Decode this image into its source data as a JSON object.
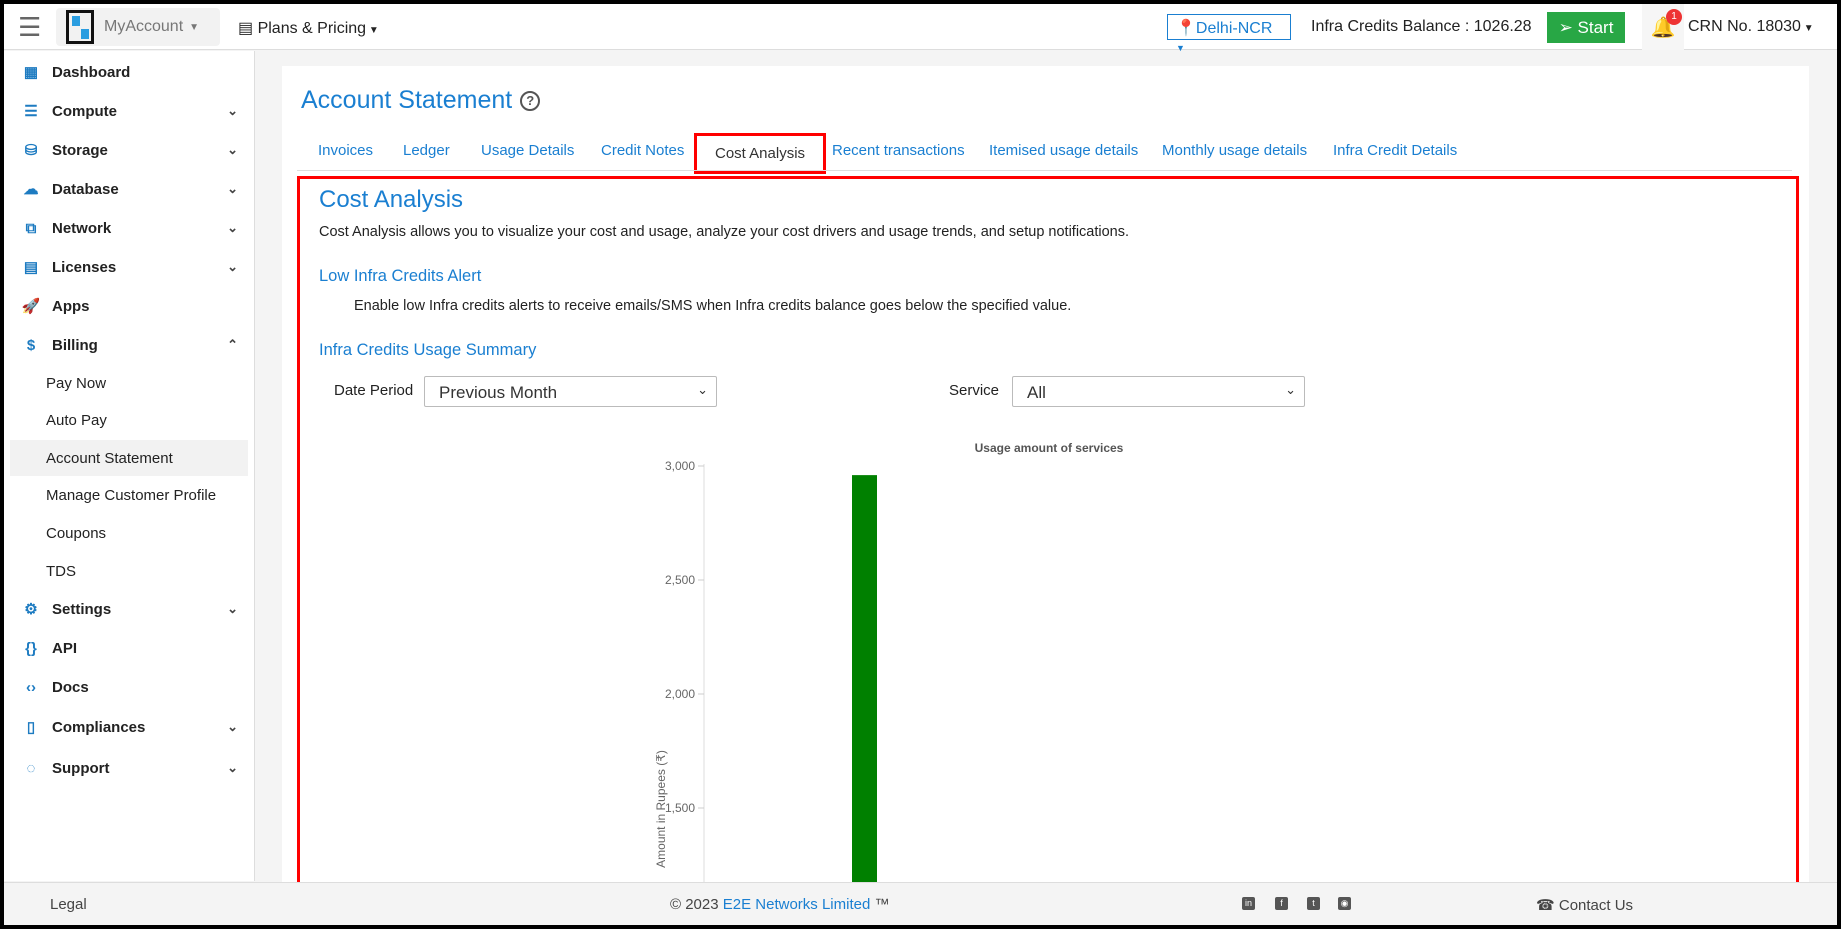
{
  "topbar": {
    "brand": "MyAccount",
    "plans": "Plans & Pricing",
    "region": "Delhi-NCR",
    "balance": "Infra Credits Balance : 1026.28",
    "start": "Start",
    "notif_count": "1",
    "crn": "CRN No. 18030",
    "logo_text": "E2E Networks"
  },
  "sidebar": {
    "items": [
      {
        "label": "Dashboard",
        "icon": "dashboard-icon",
        "chev": ""
      },
      {
        "label": "Compute",
        "icon": "server-icon",
        "chev": "down"
      },
      {
        "label": "Storage",
        "icon": "database-icon",
        "chev": "down"
      },
      {
        "label": "Database",
        "icon": "cloud-database-icon",
        "chev": "down"
      },
      {
        "label": "Network",
        "icon": "network-icon",
        "chev": "down"
      },
      {
        "label": "Licenses",
        "icon": "grid-icon",
        "chev": "down"
      },
      {
        "label": "Apps",
        "icon": "rocket-icon",
        "chev": ""
      },
      {
        "label": "Billing",
        "icon": "billing-icon",
        "chev": "up"
      }
    ],
    "billing_sub": [
      "Pay Now",
      "Auto Pay",
      "Account Statement",
      "Manage Customer Profile",
      "Coupons",
      "TDS"
    ],
    "items2": [
      {
        "label": "Settings",
        "icon": "gear-icon",
        "chev": "down"
      },
      {
        "label": "API",
        "icon": "braces-icon",
        "chev": ""
      },
      {
        "label": "Docs",
        "icon": "code-icon",
        "chev": ""
      },
      {
        "label": "Compliances",
        "icon": "document-icon",
        "chev": "down"
      },
      {
        "label": "Support",
        "icon": "support-icon",
        "chev": "down"
      }
    ]
  },
  "main": {
    "title": "Account Statement",
    "tabs": [
      "Invoices",
      "Ledger",
      "Usage Details",
      "Credit Notes",
      "Cost Analysis",
      "Recent transactions",
      "Itemised usage details",
      "Monthly usage details",
      "Infra Credit Details"
    ],
    "active_tab": "Cost Analysis",
    "section_title": "Cost Analysis",
    "section_desc": "Cost Analysis allows you to visualize your cost and usage, analyze your cost drivers and usage trends, and setup notifications.",
    "alert_title": "Low Infra Credits Alert",
    "alert_desc": "Enable low Infra credits alerts to receive emails/SMS when Infra credits balance goes below the specified value.",
    "summary_title": "Infra Credits Usage Summary",
    "date_label": "Date Period",
    "date_value": "Previous Month",
    "service_label": "Service",
    "service_value": "All"
  },
  "chart_data": {
    "type": "bar",
    "title": "Usage amount of services",
    "ylabel": "Amount in Rupees (₹)",
    "xlabel": "",
    "ylim_visible": [
      1200,
      3000
    ],
    "yticks": [
      "3,000",
      "2,500",
      "2,000",
      "1,500"
    ],
    "ytick_values": [
      3000,
      2500,
      2000,
      1500
    ],
    "values": [
      2960
    ],
    "colors": [
      "#008000"
    ]
  },
  "footer": {
    "legal": "Legal",
    "copyright_prefix": "© 2023 ",
    "company": "E2E Networks Limited",
    "tm": " ™",
    "contact": "Contact Us",
    "social": [
      "linkedin-icon",
      "facebook-icon",
      "twitter-icon",
      "rss-icon"
    ]
  },
  "colors": {
    "accent": "#1a7fd1",
    "start": "#28a745",
    "highlight": "#ff0000"
  }
}
